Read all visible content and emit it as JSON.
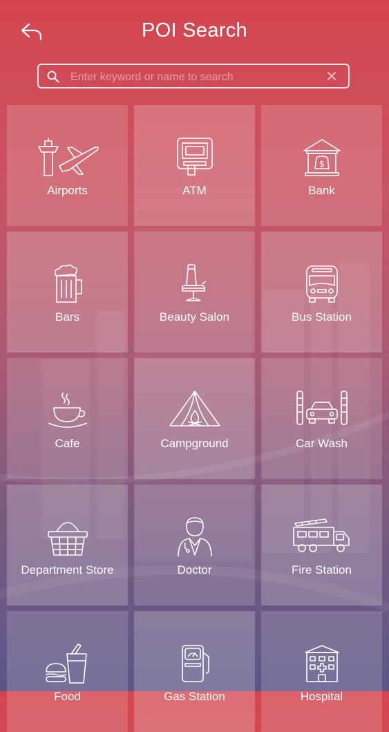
{
  "header": {
    "title": "POI Search"
  },
  "search": {
    "placeholder": "Enter keyword or name to search",
    "value": ""
  },
  "categories": [
    {
      "label": "Airports",
      "icon": "airport-icon"
    },
    {
      "label": "ATM",
      "icon": "atm-icon"
    },
    {
      "label": "Bank",
      "icon": "bank-icon"
    },
    {
      "label": "Bars",
      "icon": "beer-mug-icon"
    },
    {
      "label": "Beauty Salon",
      "icon": "salon-chair-icon"
    },
    {
      "label": "Bus Station",
      "icon": "bus-icon"
    },
    {
      "label": "Cafe",
      "icon": "coffee-cup-icon"
    },
    {
      "label": "Campground",
      "icon": "tent-icon"
    },
    {
      "label": "Car Wash",
      "icon": "car-wash-icon"
    },
    {
      "label": "Department Store",
      "icon": "basket-icon"
    },
    {
      "label": "Doctor",
      "icon": "doctor-icon"
    },
    {
      "label": "Fire Station",
      "icon": "fire-truck-icon"
    },
    {
      "label": "Food",
      "icon": "fast-food-icon"
    },
    {
      "label": "Gas Station",
      "icon": "gas-pump-icon"
    },
    {
      "label": "Hospital",
      "icon": "hospital-icon"
    }
  ],
  "colors": {
    "gradient_top": "#d4454f",
    "gradient_bottom": "#5b5687",
    "foreground": "#ffffff"
  }
}
